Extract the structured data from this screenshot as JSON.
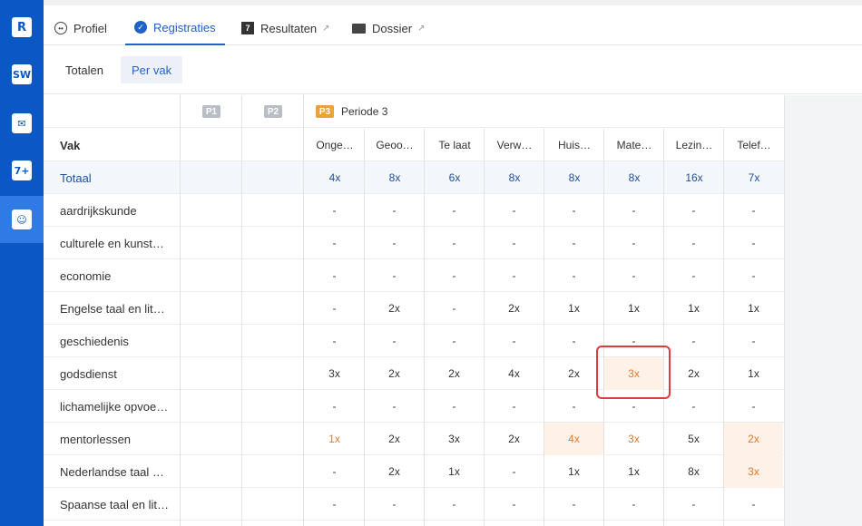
{
  "sidebar": {
    "items": [
      {
        "icon": "calendar-r-icon",
        "glyph": "R"
      },
      {
        "icon": "studiewijzer-icon",
        "glyph": "SW"
      },
      {
        "icon": "inbox-icon",
        "glyph": "✉"
      },
      {
        "icon": "grades-icon",
        "glyph": "7+"
      },
      {
        "icon": "students-icon",
        "glyph": "☺"
      }
    ]
  },
  "tabs": [
    {
      "label": "Profiel"
    },
    {
      "label": "Registraties"
    },
    {
      "label": "Resultaten"
    },
    {
      "label": "Dossier"
    }
  ],
  "subtabs": [
    {
      "label": "Totalen"
    },
    {
      "label": "Per vak"
    }
  ],
  "periods": [
    {
      "badge": "P1",
      "color": "#b9bec6"
    },
    {
      "badge": "P2",
      "color": "#b9bec6"
    },
    {
      "badge": "P3",
      "label": "Periode 3",
      "color": "#e8a33a"
    }
  ],
  "table": {
    "vak_header": "Vak",
    "columns": [
      "Onge…",
      "Geoo…",
      "Te laat",
      "Verw…",
      "Huis…",
      "Mate…",
      "Lezin…",
      "Telef…"
    ],
    "totaal": {
      "label": "Totaal",
      "values": [
        "4x",
        "8x",
        "6x",
        "8x",
        "8x",
        "8x",
        "16x",
        "7x"
      ]
    },
    "rows": [
      {
        "name": "aardrijkskunde",
        "values": [
          "-",
          "-",
          "-",
          "-",
          "-",
          "-",
          "-",
          "-"
        ]
      },
      {
        "name": "culturele en kunst…",
        "values": [
          "-",
          "-",
          "-",
          "-",
          "-",
          "-",
          "-",
          "-"
        ]
      },
      {
        "name": "economie",
        "values": [
          "-",
          "-",
          "-",
          "-",
          "-",
          "-",
          "-",
          "-"
        ]
      },
      {
        "name": "Engelse taal en lit…",
        "values": [
          "-",
          "2x",
          "-",
          "2x",
          "1x",
          "1x",
          "1x",
          "1x"
        ]
      },
      {
        "name": "geschiedenis",
        "values": [
          "-",
          "-",
          "-",
          "-",
          "-",
          "-",
          "-",
          "-"
        ]
      },
      {
        "name": "godsdienst",
        "values": [
          "3x",
          "2x",
          "2x",
          "4x",
          "2x",
          "3x",
          "2x",
          "1x"
        ]
      },
      {
        "name": "lichamelijke opvoe…",
        "values": [
          "-",
          "-",
          "-",
          "-",
          "-",
          "-",
          "-",
          "-"
        ]
      },
      {
        "name": "mentorlessen",
        "values": [
          "1x",
          "2x",
          "3x",
          "2x",
          "4x",
          "3x",
          "5x",
          "2x"
        ]
      },
      {
        "name": "Nederlandse taal …",
        "values": [
          "-",
          "2x",
          "1x",
          "-",
          "1x",
          "1x",
          "8x",
          "3x"
        ]
      },
      {
        "name": "Spaanse taal en lit…",
        "values": [
          "-",
          "-",
          "-",
          "-",
          "-",
          "-",
          "-",
          "-"
        ]
      }
    ]
  },
  "colors": {
    "accent": "#1e62c8",
    "sidebar": "#0b57c4",
    "warn": "#e07a2a",
    "annotation": "#e03b3b"
  }
}
